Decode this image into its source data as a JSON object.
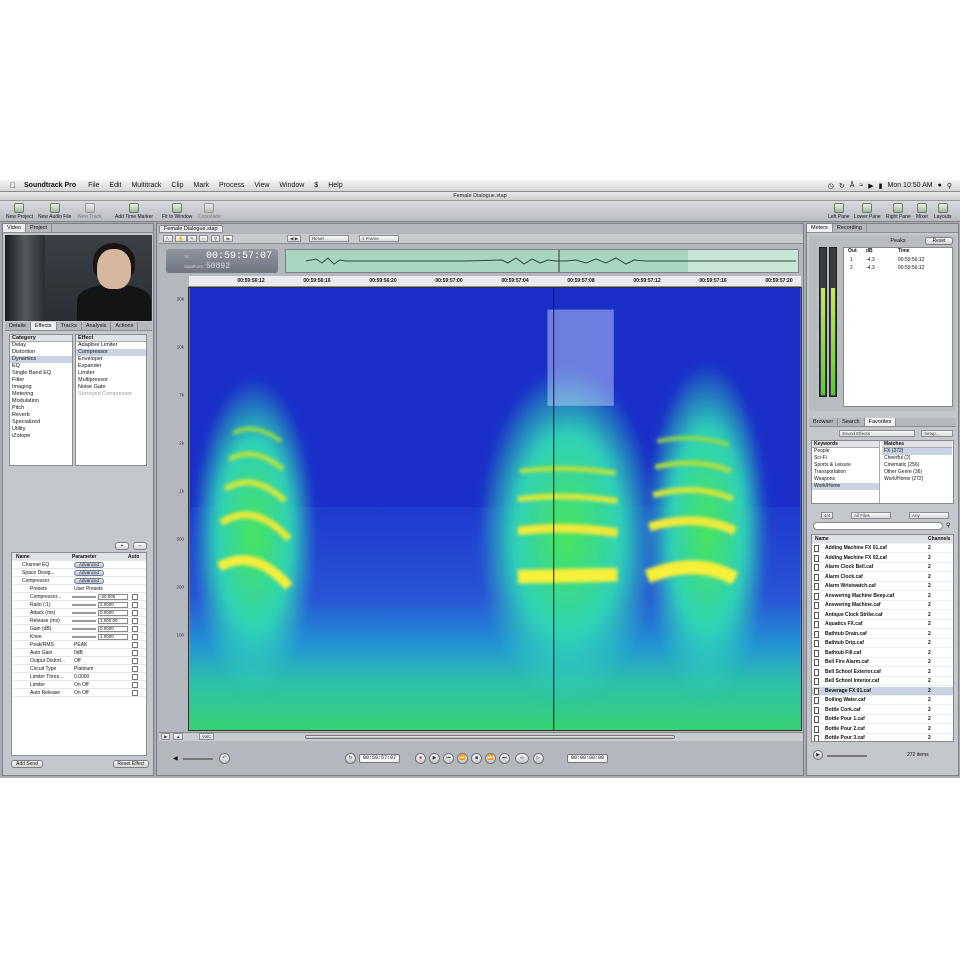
{
  "menubar": {
    "app_name": "Soundtrack Pro",
    "items": [
      "File",
      "Edit",
      "Multitrack",
      "Clip",
      "Mark",
      "Process",
      "View",
      "Window",
      "$",
      "Help"
    ],
    "clock": "Mon 10:50 AM"
  },
  "window_title": "Female Dialogue.stap",
  "toolbar": {
    "left": [
      "New Project",
      "New Audio File",
      "New Track",
      "Add Time Marker",
      "Fit to Window",
      "Crossfade"
    ],
    "right": [
      "Left Pane",
      "Lower Pane",
      "Right Pane",
      "Mixer",
      "Layouts"
    ]
  },
  "left_pane": {
    "top_tabs": [
      "Video",
      "Project"
    ],
    "fit_label": "Fit to Window",
    "sub_tabs": [
      "Details",
      "Effects",
      "Tracks",
      "Analysis",
      "Actions"
    ],
    "category_header": "Category",
    "categories": [
      "Delay",
      "Distortion",
      "Dynamics",
      "EQ",
      "Single Band EQ",
      "Filter",
      "Imaging",
      "Metering",
      "Modulation",
      "Pitch",
      "Reverb",
      "Specialized",
      "Utility",
      "iZotope"
    ],
    "selected_category": "Dynamics",
    "effect_header": "Effect",
    "effects": [
      "Adaptive Limiter",
      "Compressor",
      "Enveloper",
      "Expander",
      "Limiter",
      "Multipressor",
      "Noise Gate",
      "Surround Compressor"
    ],
    "selected_effect": "Compressor",
    "params_headers": {
      "name": "Name",
      "parameter": "Parameter",
      "auto": "Auto"
    },
    "effect_rows": [
      {
        "name": "Channel EQ",
        "parameter": "Advanced"
      },
      {
        "name": "Space Desig...",
        "parameter": "Advanced"
      },
      {
        "name": "Compressor",
        "parameter": "Advanced"
      }
    ],
    "presets_label": "Presets",
    "presets_value": "User Presets",
    "params": [
      {
        "name": "Compressor...",
        "value": "-20.000"
      },
      {
        "name": "Ratio (:1)",
        "value": "2.0000"
      },
      {
        "name": "Attack (ms)",
        "value": "0.0000"
      },
      {
        "name": "Release (ms)",
        "value": "1,000.00"
      },
      {
        "name": "Gain (dB)",
        "value": "0.0000"
      },
      {
        "name": "Knee",
        "value": "1.0000"
      },
      {
        "name": "Peak/RMS",
        "value": "PEAK"
      },
      {
        "name": "Auto Gain",
        "value": "0dB"
      },
      {
        "name": "Output Distort...",
        "value": "Off"
      },
      {
        "name": "Circuit Type",
        "value": "Platinum"
      },
      {
        "name": "Limiter Thres...",
        "value": "0.0000"
      },
      {
        "name": "Limiter",
        "value": "On  Off"
      },
      {
        "name": "Auto Release",
        "value": "On  Off"
      }
    ],
    "add_send": "Add Send",
    "reset_effect": "Reset Effect"
  },
  "editor": {
    "file_tab": "Female Dialogue.stap",
    "zoom_label": "1 Frame",
    "tool_label": "Reset",
    "timecode": "00:59:57:07",
    "samples": "50892",
    "timecode_label": "TC",
    "samples_label": "SAMPLES",
    "ruler": [
      "00:59:56:12",
      "00:59:56:16",
      "00:59:56:20",
      "00:59:57:00",
      "00:59:57:04",
      "00:59:57:08",
      "00:59:57:12",
      "00:59:57:16",
      "00:59:57:20"
    ],
    "freq_labels": [
      "20k",
      "10k",
      "7k",
      "2k",
      "1k",
      "500",
      "200",
      "100"
    ],
    "zoom_mode": "ValC",
    "transport_tc_start": "00:59:57:07",
    "transport_tc_len": "00:00:00:00"
  },
  "right_pane": {
    "tabs": [
      "Meters",
      "Recording"
    ],
    "peaks_title": "Peaks",
    "reset": "Reset",
    "peak_headers": [
      "Out",
      "dB",
      "Time"
    ],
    "peak_rows": [
      {
        "out": "1",
        "db": "-4.3",
        "time": "00:59:56:12"
      },
      {
        "out": "2",
        "db": "-4.3",
        "time": "00:59:56:12"
      }
    ],
    "meter_levels": [
      0.72,
      0.72
    ],
    "browser_tabs": [
      "Browser",
      "Search",
      "Favorites"
    ],
    "search_scope": "Sound Effects",
    "setup": "Setup...",
    "keywords_header": "Keywords",
    "keywords": [
      "People",
      "Sci-Fi",
      "Sports & Leisure",
      "Transportation",
      "Weapons",
      "Work/Home"
    ],
    "selected_keyword": "Work/Home",
    "matches_header": "Matches",
    "matches": [
      "FX (272)",
      "Cheerful (2)",
      "Cinematic (256)",
      "Other Genre (36)",
      "Work/Home (272)"
    ],
    "filter_count": "4/4",
    "filter_files": "All Files",
    "filter_any": "Any",
    "files_headers": {
      "name": "Name",
      "channels": "Channels"
    },
    "files": [
      {
        "name": "Adding Machine FX 01.caf",
        "ch": "2"
      },
      {
        "name": "Adding Machine FX 02.caf",
        "ch": "2"
      },
      {
        "name": "Alarm Clock Bell.caf",
        "ch": "2"
      },
      {
        "name": "Alarm Clock.caf",
        "ch": "2"
      },
      {
        "name": "Alarm Wristwatch.caf",
        "ch": "2"
      },
      {
        "name": "Answering Machine Beep.caf",
        "ch": "2"
      },
      {
        "name": "Answering Machine.caf",
        "ch": "2"
      },
      {
        "name": "Antique Clock Strike.caf",
        "ch": "2"
      },
      {
        "name": "Aquatics FX.caf",
        "ch": "2"
      },
      {
        "name": "Bathtub Drain.caf",
        "ch": "2"
      },
      {
        "name": "Bathtub Drip.caf",
        "ch": "2"
      },
      {
        "name": "Bathtub Fill.caf",
        "ch": "2"
      },
      {
        "name": "Bell Fire Alarm.caf",
        "ch": "2"
      },
      {
        "name": "Bell School Exterior.caf",
        "ch": "2"
      },
      {
        "name": "Bell School Interior.caf",
        "ch": "2"
      },
      {
        "name": "Beverage FX 01.caf",
        "ch": "2"
      },
      {
        "name": "Boiling Water.caf",
        "ch": "2"
      },
      {
        "name": "Bottle Cork.caf",
        "ch": "2"
      },
      {
        "name": "Bottle Pour 1.caf",
        "ch": "2"
      },
      {
        "name": "Bottle Pour 2.caf",
        "ch": "2"
      },
      {
        "name": "Bottle Pour 3.caf",
        "ch": "2"
      }
    ],
    "selected_file": "Beverage FX 01.caf",
    "items_count": "272 items"
  },
  "colors": {
    "spectrum_bg": "#1a2fc8",
    "spectrum_hot": "#f6f03a",
    "accent_sel": "#c9d3e3"
  }
}
